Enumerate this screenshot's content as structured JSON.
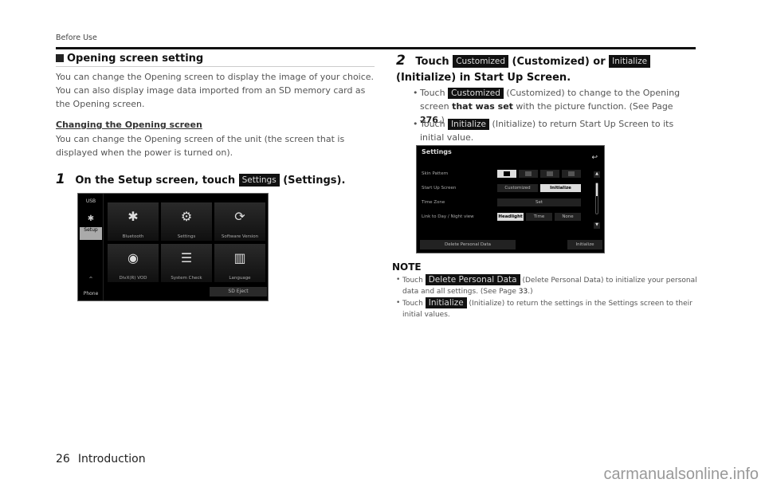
{
  "header": {
    "section_label": "Before Use"
  },
  "left": {
    "title": "Opening screen setting",
    "intro": "You can change the Opening screen to display the image of your choice. You can also display image data imported from an SD memory card as the Opening screen.",
    "subheading": "Changing the Opening screen",
    "sub_text": "You can change the Opening screen of the unit (the screen that is displayed when the power is turned on).",
    "step1": {
      "number": "1",
      "pre": "On the Setup screen, touch",
      "chip": "Settings",
      "post": "(Settings)."
    },
    "setup_screen": {
      "side_items": [
        "USB",
        "Bluetooth",
        "Setup",
        "^",
        "Phone"
      ],
      "tiles": [
        {
          "icon": "bluetooth-icon",
          "glyph": "✱",
          "label": "Bluetooth"
        },
        {
          "icon": "wrench-gear-icon",
          "glyph": "⚙",
          "label": "Settings"
        },
        {
          "icon": "refresh-icon",
          "glyph": "⟳",
          "label": "Software Version"
        },
        {
          "icon": "disc-icon",
          "glyph": "◉",
          "label": "DivX(R) VOD"
        },
        {
          "icon": "checklist-icon",
          "glyph": "☰",
          "label": "System Check"
        },
        {
          "icon": "book-icon",
          "glyph": "▥",
          "label": "Language"
        }
      ],
      "eject": "SD Eject"
    }
  },
  "right": {
    "step2": {
      "number": "2",
      "pre": "Touch",
      "chip1": "Customized",
      "mid1": "(Customized) or",
      "chip2": "Initialize",
      "post": "(Initialize) in Start Up Screen."
    },
    "bullets": [
      {
        "pre": "Touch",
        "chip": "Customized",
        "text1": "(Customized) to change to the Opening screen",
        "bold1": "that was set",
        "text2": "with the picture function. (See Page",
        "page": "276",
        "end": ".)"
      },
      {
        "pre": "Touch",
        "chip": "Initialize",
        "text1": "(Initialize) to return Start Up Screen to its initial value."
      }
    ],
    "settings_screen": {
      "title": "Settings",
      "back_glyph": "↩",
      "rows": [
        "Skin Pattern",
        "Start Up Screen",
        "Time Zone",
        "Link to Day / Night view"
      ],
      "startup_options": [
        "Customized",
        "Initialize"
      ],
      "timezone_button": "Set",
      "daynight_options": [
        "Headlight",
        "Time",
        "None"
      ],
      "delete_button": "Delete Personal Data",
      "initialize_button": "Initialize",
      "scroll_up": "▲",
      "scroll_down": "▼"
    },
    "note": {
      "title": "NOTE",
      "items": [
        {
          "pre": "Touch",
          "chip": "Delete Personal Data",
          "text": "(Delete Personal Data) to initialize your personal data and all settings. (See Page",
          "page": "33",
          "end": ".)"
        },
        {
          "pre": "Touch",
          "chip": "Initialize",
          "text": "(Initialize) to return the settings in the Settings screen to their initial values."
        }
      ]
    }
  },
  "footer": {
    "page_number": "26",
    "chapter": "Introduction",
    "watermark": "carmanualsonline.info"
  }
}
